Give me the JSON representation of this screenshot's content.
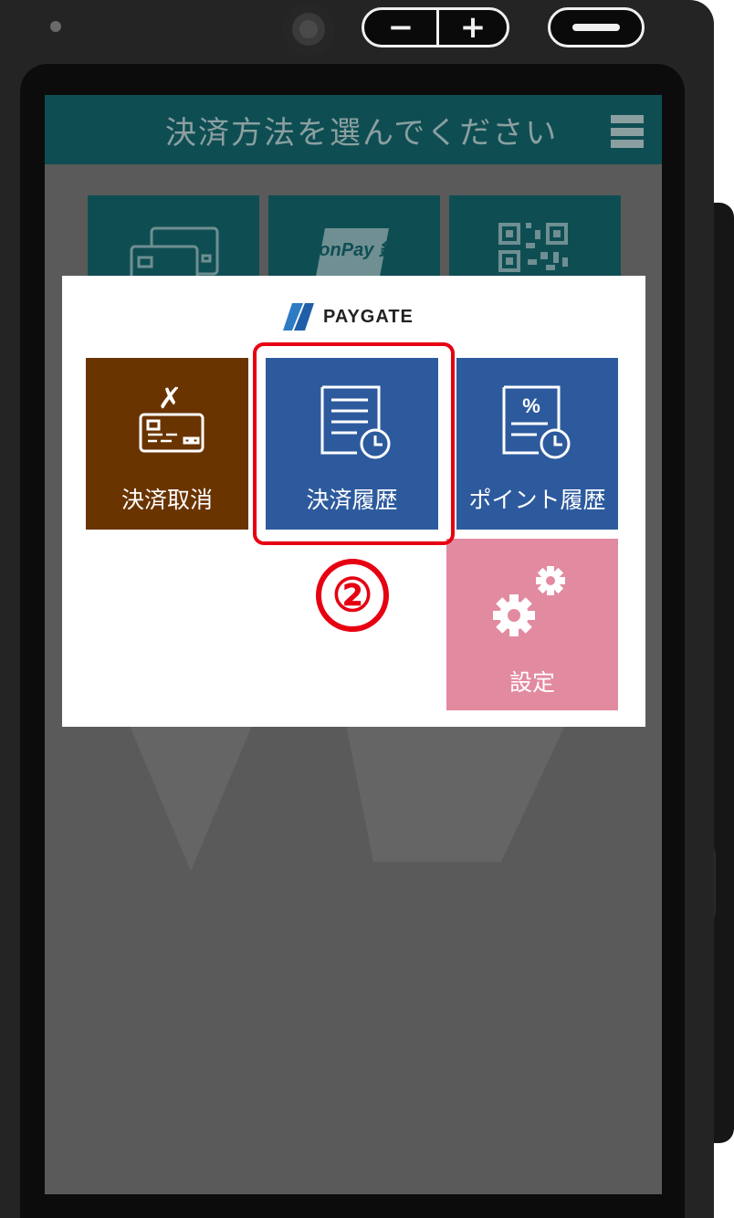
{
  "device": {
    "volume_down_label": "−",
    "volume_up_label": "+"
  },
  "header": {
    "title": "決済方法を選んでください",
    "menu_icon": "hamburger-icon"
  },
  "background_tiles": [
    {
      "icon": "credit-card-icon"
    },
    {
      "icon": "unionpay-logo",
      "logo_text": "UnionPay 銀聯"
    },
    {
      "icon": "qr-code-icon"
    }
  ],
  "modal": {
    "brand": "PAYGATE",
    "tiles": {
      "cancel": {
        "label": "決済取消",
        "icon": "card-cancel-icon",
        "color": "#6a3400"
      },
      "history": {
        "label": "決済履歴",
        "icon": "document-clock-icon",
        "color": "#2d5a9d"
      },
      "points": {
        "label": "ポイント履歴",
        "icon": "percent-document-clock-icon",
        "color": "#2d5a9d"
      },
      "settings": {
        "label": "設定",
        "icon": "gears-icon",
        "color": "#e28aa0"
      }
    }
  },
  "annotation": {
    "step": "②",
    "highlight_color": "#e60012"
  }
}
